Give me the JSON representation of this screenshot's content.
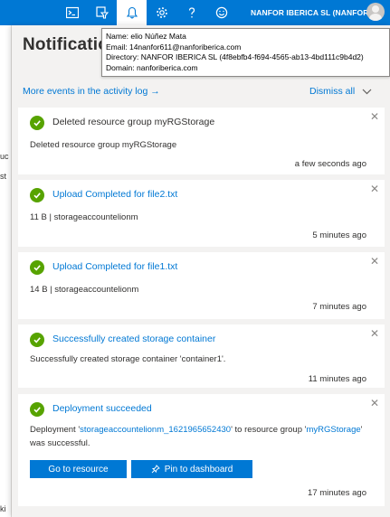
{
  "topbar": {
    "account": "NANFOR IBERICA SL (NANFORIB..."
  },
  "tooltip": {
    "name": "Name: elio Núñez Mata",
    "email": "Email: 14nanfor611@nanforiberica.com",
    "directory": "Directory: NANFOR IBERICA SL (4f8ebfb4-f694-4565-ab13-4bd111c9b4d2)",
    "domain": "Domain: nanforiberica.com"
  },
  "background": {
    "fragments": [
      "uc",
      "st",
      "ki"
    ]
  },
  "panel": {
    "title": "Notifications",
    "more_events": "More events in the activity log →",
    "dismiss_all": "Dismiss all"
  },
  "notifications": [
    {
      "title": "Deleted resource group myRGStorage",
      "description": "Deleted resource group myRGStorage",
      "time": "a few seconds ago"
    },
    {
      "title": "Upload Completed for file2.txt",
      "description": "11 B | storageaccountelionm",
      "time": "5 minutes ago"
    },
    {
      "title": "Upload Completed for file1.txt",
      "description": "14 B | storageaccountelionm",
      "time": "7 minutes ago"
    },
    {
      "title": "Successfully created storage container",
      "description": "Successfully created storage container 'container1'.",
      "time": "11 minutes ago"
    },
    {
      "title": "Deployment succeeded",
      "desc_prefix": "Deployment '",
      "desc_deployment": "storageaccountelionm_1621965652430",
      "desc_middle": "' to resource group '",
      "desc_group": "myRGStorage",
      "desc_suffix": "' was successful.",
      "button_go": "Go to resource",
      "button_pin": "Pin to dashboard",
      "time": "17 minutes ago"
    }
  ],
  "colors": {
    "accent": "#0078d4",
    "success": "#57a300",
    "panel_bg": "#f3f2f1"
  }
}
